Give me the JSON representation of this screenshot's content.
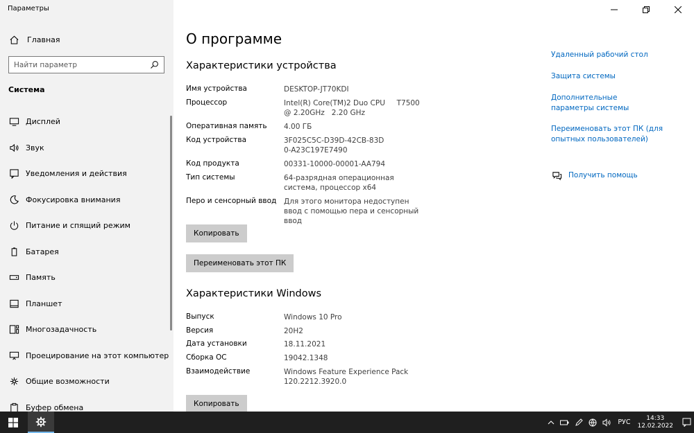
{
  "window": {
    "title": "Параметры"
  },
  "sidebar": {
    "home_label": "Главная",
    "search_placeholder": "Найти параметр",
    "section_label": "Система",
    "items": [
      {
        "label": "Дисплей",
        "icon": "display-icon"
      },
      {
        "label": "Звук",
        "icon": "sound-icon"
      },
      {
        "label": "Уведомления и действия",
        "icon": "notifications-icon"
      },
      {
        "label": "Фокусировка внимания",
        "icon": "focus-assist-icon"
      },
      {
        "label": "Питание и спящий режим",
        "icon": "power-icon"
      },
      {
        "label": "Батарея",
        "icon": "battery-icon"
      },
      {
        "label": "Память",
        "icon": "storage-icon"
      },
      {
        "label": "Планшет",
        "icon": "tablet-icon"
      },
      {
        "label": "Многозадачность",
        "icon": "multitasking-icon"
      },
      {
        "label": "Проецирование на этот компьютер",
        "icon": "projecting-icon"
      },
      {
        "label": "Общие возможности",
        "icon": "shared-experiences-icon"
      },
      {
        "label": "Буфер обмена",
        "icon": "clipboard-icon"
      }
    ]
  },
  "main": {
    "title": "О программе",
    "device_section": {
      "heading": "Характеристики устройства",
      "specs": [
        {
          "key": "Имя устройства",
          "value": "DESKTOP-JT70KDI"
        },
        {
          "key": "Процессор",
          "value": "Intel(R) Core(TM)2 Duo CPU     T7500  @ 2.20GHz   2.20 GHz"
        },
        {
          "key": "Оперативная память",
          "value": "4.00 ГБ"
        },
        {
          "key": "Код устройства",
          "value": "3F025C5C-D39D-42CB-83D0-A23C197E7490"
        },
        {
          "key": "Код продукта",
          "value": "00331-10000-00001-AA794"
        },
        {
          "key": "Тип системы",
          "value": "64-разрядная операционная система, процессор x64"
        },
        {
          "key": "Перо и сенсорный ввод",
          "value": "Для этого монитора недоступен ввод с помощью пера и сенсорный ввод"
        }
      ],
      "copy_label": "Копировать",
      "rename_label": "Переименовать этот ПК"
    },
    "windows_section": {
      "heading": "Характеристики Windows",
      "specs": [
        {
          "key": "Выпуск",
          "value": "Windows 10 Pro"
        },
        {
          "key": "Версия",
          "value": "20H2"
        },
        {
          "key": "Дата установки",
          "value": "18.11.2021"
        },
        {
          "key": "Сборка ОС",
          "value": "19042.1348"
        },
        {
          "key": "Взаимодействие",
          "value": "Windows Feature Experience Pack 120.2212.3920.0"
        }
      ],
      "copy_label": "Копировать"
    }
  },
  "related_links": [
    "Удаленный рабочий стол",
    "Защита системы",
    "Дополнительные параметры системы",
    "Переименовать этот ПК (для опытных пользователей)"
  ],
  "help_label": "Получить помощь",
  "taskbar": {
    "language": "РУС",
    "time": "14:33",
    "date": "12.02.2022"
  },
  "colors": {
    "link": "#0067c0",
    "sidebar_bg": "#f2f2f2",
    "button_bg": "#cccccc",
    "taskbar_bg": "#1f1f1f"
  }
}
